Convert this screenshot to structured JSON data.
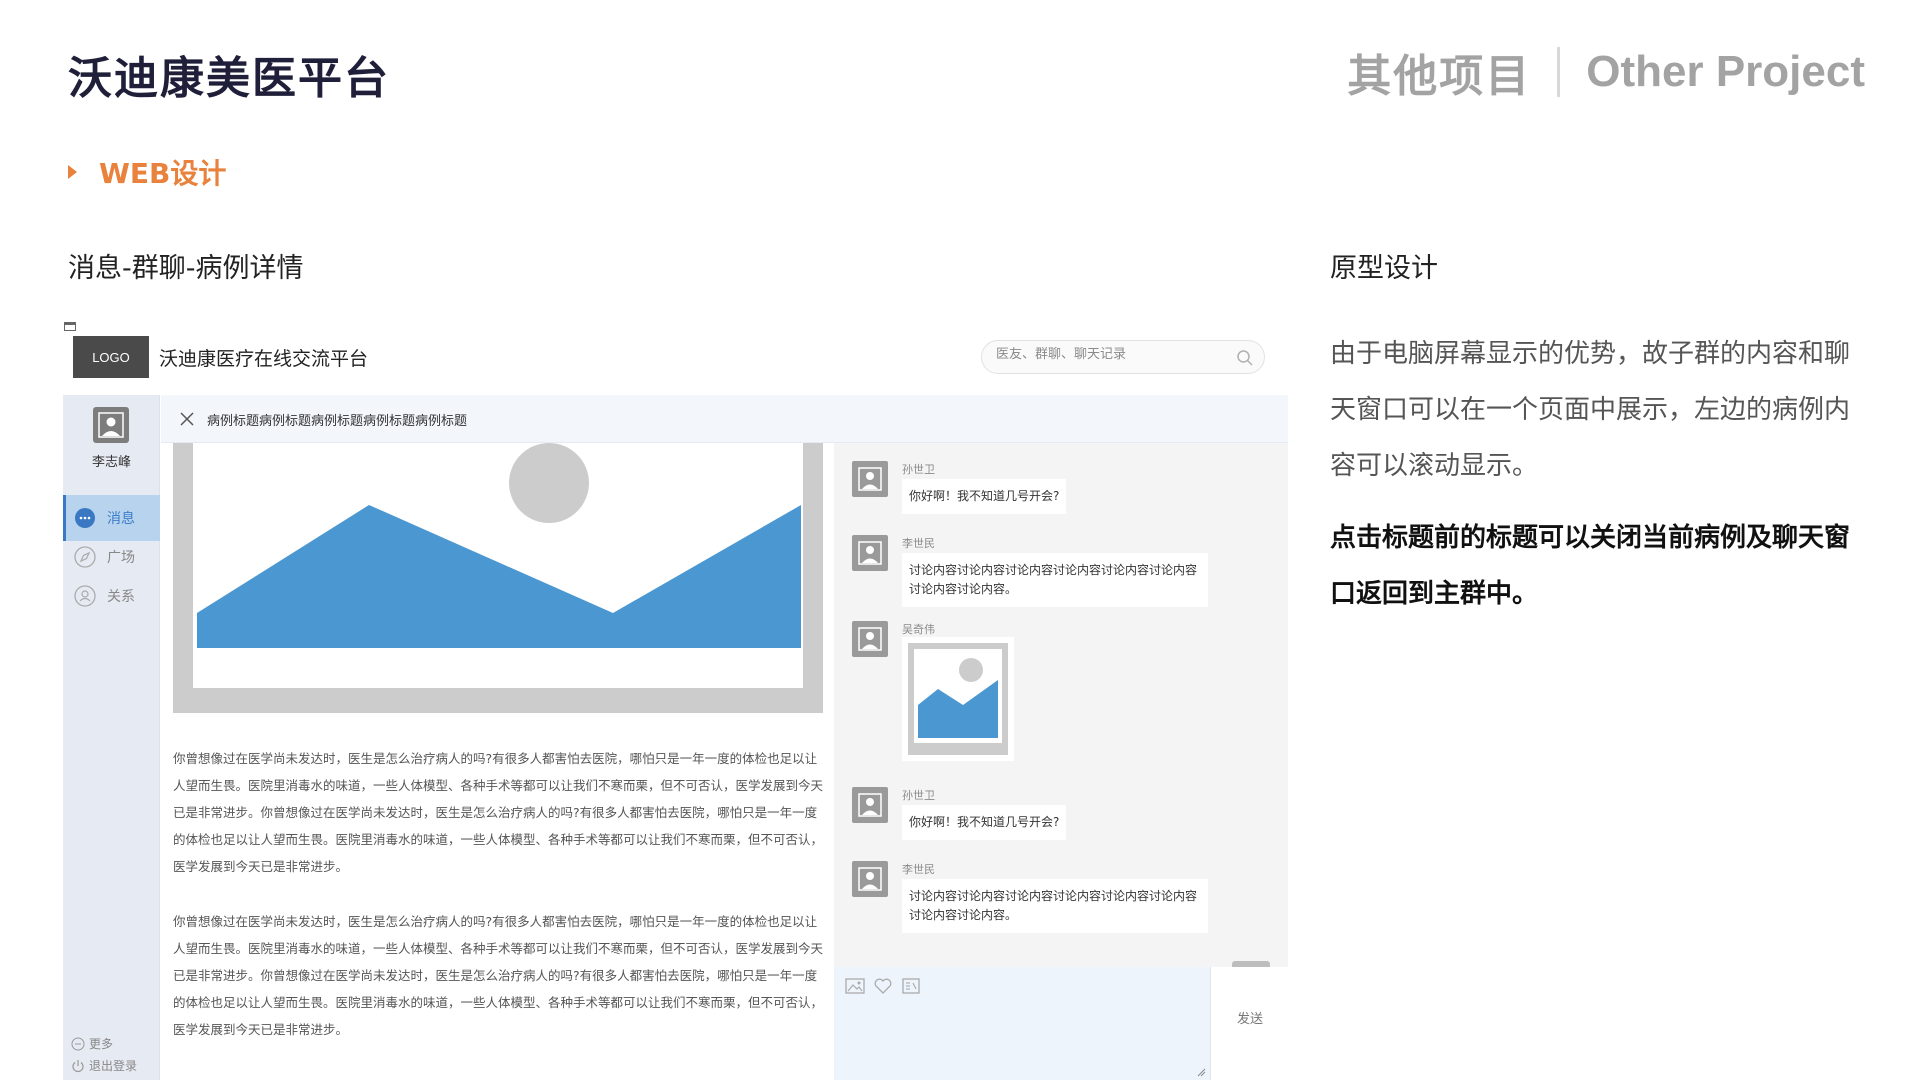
{
  "header": {
    "title": "沃迪康美医平台",
    "right_cn": "其他项目",
    "right_en": "Other Project"
  },
  "section_tag": "WEB设计",
  "mock_caption": "消息-群聊-病例详情",
  "prototype": {
    "title": "原型设计",
    "description": "由于电脑屏幕显示的优势，故子群的内容和聊天窗口可以在一个页面中展示，左边的病例内容可以滚动显示。",
    "note": "点击标题前的标题可以关闭当前病例及聊天窗口返回到主群中。"
  },
  "mockup": {
    "logo": "LOGO",
    "app_name": "沃迪康医疗在线交流平台",
    "search_placeholder": "医友、群聊、聊天记录",
    "user_name": "李志峰",
    "nav": [
      {
        "label": "消息",
        "icon": "message-icon",
        "active": true
      },
      {
        "label": "广场",
        "icon": "compass-icon",
        "active": false
      },
      {
        "label": "关系",
        "icon": "contacts-icon",
        "active": false
      }
    ],
    "bottom": {
      "more": "更多",
      "logout": "退出登录"
    },
    "case_title": "病例标题病例标题病例标题病例标题病例标题",
    "case_paragraphs": [
      "你曾想像过在医学尚未发达时，医生是怎么治疗病人的吗?有很多人都害怕去医院，哪怕只是一年一度的体检也足以让人望而生畏。医院里消毒水的味道，一些人体模型、各种手术等都可以让我们不寒而栗，但不可否认，医学发展到今天已是非常进步。你曾想像过在医学尚未发达时，医生是怎么治疗病人的吗?有很多人都害怕去医院，哪怕只是一年一度的体检也足以让人望而生畏。医院里消毒水的味道，一些人体模型、各种手术等都可以让我们不寒而栗，但不可否认，医学发展到今天已是非常进步。",
      "你曾想像过在医学尚未发达时，医生是怎么治疗病人的吗?有很多人都害怕去医院，哪怕只是一年一度的体检也足以让人望而生畏。医院里消毒水的味道，一些人体模型、各种手术等都可以让我们不寒而栗，但不可否认，医学发展到今天已是非常进步。你曾想像过在医学尚未发达时，医生是怎么治疗病人的吗?有很多人都害怕去医院，哪怕只是一年一度的体检也足以让人望而生畏。医院里消毒水的味道，一些人体模型、各种手术等都可以让我们不寒而栗，但不可否认，医学发展到今天已是非常进步。"
    ],
    "messages": [
      {
        "sender": "孙世卫",
        "text": "你好啊！我不知道几号开会?"
      },
      {
        "sender": "李世民",
        "text": "讨论内容讨论内容讨论内容讨论内容讨论内容讨论内容讨论内容讨论内容。"
      },
      {
        "sender": "吴奇伟",
        "text": ""
      },
      {
        "sender": "孙世卫",
        "text": "你好啊！我不知道几号开会?"
      },
      {
        "sender": "李世民",
        "text": "讨论内容讨论内容讨论内容讨论内容讨论内容讨论内容讨论内容讨论内容。"
      }
    ],
    "send_label": "发送"
  },
  "colors": {
    "accent_orange": "#e8823c",
    "mountain_blue": "#4a97d1",
    "nav_active_bg": "#b8d3ee",
    "title_dark": "#1f1f3a"
  }
}
